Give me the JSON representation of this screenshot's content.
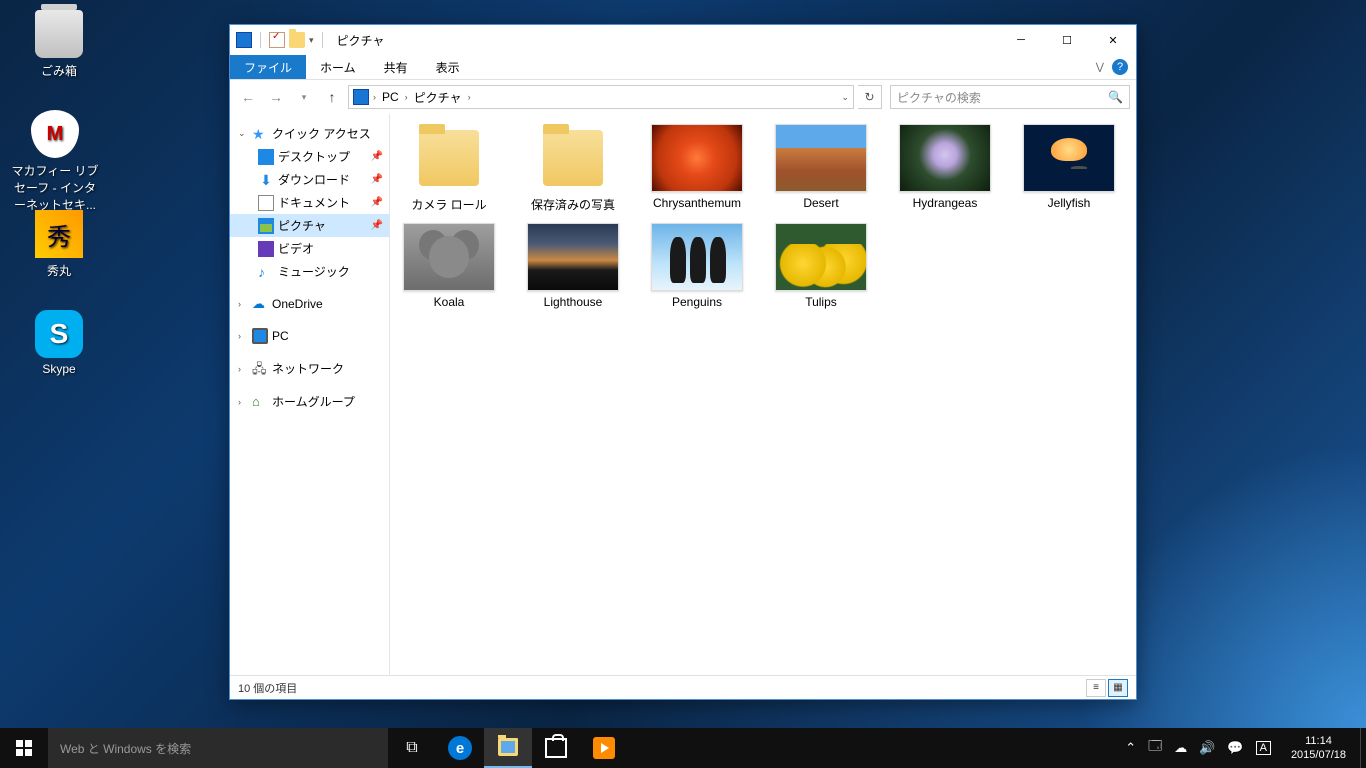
{
  "desktop_icons": [
    {
      "name": "recycle-bin",
      "label": "ごみ箱"
    },
    {
      "name": "mcafee",
      "label": "マカフィー リブセーフ - インターネットセキ..."
    },
    {
      "name": "hidemaru",
      "label": "秀丸"
    },
    {
      "name": "skype",
      "label": "Skype"
    }
  ],
  "explorer": {
    "title": "ピクチャ",
    "tabs": {
      "file": "ファイル",
      "home": "ホーム",
      "share": "共有",
      "view": "表示"
    },
    "breadcrumb": [
      "PC",
      "ピクチャ"
    ],
    "search_placeholder": "ピクチャの検索",
    "nav": {
      "quick_access": "クイック アクセス",
      "desktop": "デスクトップ",
      "downloads": "ダウンロード",
      "documents": "ドキュメント",
      "pictures": "ピクチャ",
      "videos": "ビデオ",
      "music": "ミュージック",
      "onedrive": "OneDrive",
      "pc": "PC",
      "network": "ネットワーク",
      "homegroup": "ホームグループ"
    },
    "items": [
      {
        "name": "camera-roll",
        "label": "カメラ ロール",
        "type": "folder"
      },
      {
        "name": "saved-pictures",
        "label": "保存済みの写真",
        "type": "folder"
      },
      {
        "name": "chrysanthemum",
        "label": "Chrysanthemum",
        "type": "image",
        "thumb": "t-chrys"
      },
      {
        "name": "desert",
        "label": "Desert",
        "type": "image",
        "thumb": "t-desert"
      },
      {
        "name": "hydrangeas",
        "label": "Hydrangeas",
        "type": "image",
        "thumb": "t-hydra"
      },
      {
        "name": "jellyfish",
        "label": "Jellyfish",
        "type": "image",
        "thumb": "t-jelly"
      },
      {
        "name": "koala",
        "label": "Koala",
        "type": "image",
        "thumb": "t-koala"
      },
      {
        "name": "lighthouse",
        "label": "Lighthouse",
        "type": "image",
        "thumb": "t-light"
      },
      {
        "name": "penguins",
        "label": "Penguins",
        "type": "image",
        "thumb": "t-peng"
      },
      {
        "name": "tulips",
        "label": "Tulips",
        "type": "image",
        "thumb": "t-tulips"
      }
    ],
    "status": "10 個の項目"
  },
  "taskbar": {
    "search_placeholder": "Web と Windows を検索",
    "ime": "A",
    "time": "11:14",
    "date": "2015/07/18"
  }
}
